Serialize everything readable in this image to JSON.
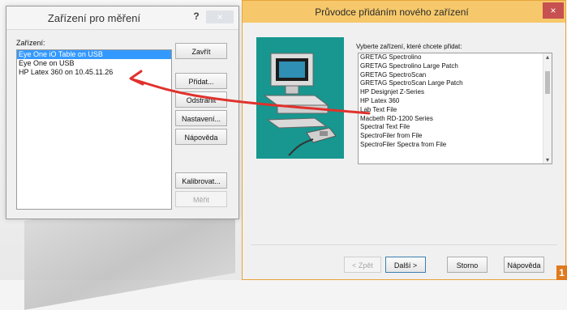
{
  "left_window": {
    "title": "Zařízení pro měření",
    "help_label": "?",
    "close_label": "×",
    "devices_label": "Zařízení:",
    "devices": [
      "Eye One iO Table on USB",
      "Eye One on USB",
      "HP Latex 360 on 10.45.11.26"
    ],
    "selected_index": 0,
    "buttons": {
      "close": "Zavřít",
      "add": "Přidat...",
      "remove": "Odstranit",
      "settings": "Nastavení...",
      "help": "Nápověda",
      "calibrate": "Kalibrovat...",
      "measure": "Měřit"
    }
  },
  "right_window": {
    "title": "Průvodce přidáním nového zařízení",
    "close_label": "×",
    "prompt": "Vyberte zařízení, které chcete přidat:",
    "models": [
      "GRETAG Spectrolino",
      "GRETAG Spectrolino Large Patch",
      "GRETAG SpectroScan",
      "GRETAG SpectroScan Large Patch",
      "HP Designjet Z-Series",
      "HP Latex 360",
      "Lab Text File",
      "Macbeth RD-1200 Series",
      "Spectral Text File",
      "SpectroFiler from File",
      "SpectroFiler Spectra from File"
    ],
    "buttons": {
      "back": "< Zpět",
      "next": "Další >",
      "cancel": "Storno",
      "help": "Nápověda"
    }
  },
  "badge": "1",
  "colors": {
    "selection": "#3399ff",
    "accent_arrow": "#e0312c",
    "illustration_bg": "#17978f",
    "wizard_title_bg": "#f6c86b"
  }
}
